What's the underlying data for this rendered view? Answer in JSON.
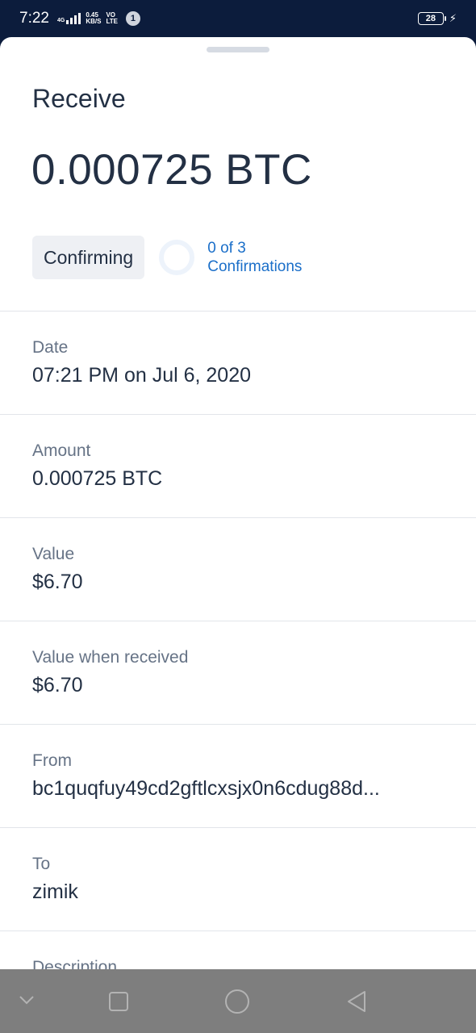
{
  "status_bar": {
    "time": "7:22",
    "network_type": "4G",
    "speed_value": "0.45",
    "speed_unit": "KB/S",
    "volte_top": "VO",
    "volte_bottom": "LTE",
    "notification_count": "1",
    "battery_level": "28",
    "icons": [
      "signal-icon",
      "battery-icon",
      "charging-bolt-icon"
    ]
  },
  "sheet": {
    "title": "Receive",
    "amount": "0.000725 BTC",
    "status_badge": "Confirming",
    "confirmations_line1": "0 of 3",
    "confirmations_line2": "Confirmations",
    "details": [
      {
        "label": "Date",
        "value": "07:21 PM on Jul 6, 2020"
      },
      {
        "label": "Amount",
        "value": "0.000725 BTC"
      },
      {
        "label": "Value",
        "value": "$6.70"
      },
      {
        "label": "Value when received",
        "value": "$6.70"
      },
      {
        "label": "From",
        "value": "bc1quqfuy49cd2gftlcxsjx0n6cdug88d..."
      },
      {
        "label": "To",
        "value": "zimik"
      },
      {
        "label": "Description",
        "value": ""
      }
    ]
  },
  "colors": {
    "accent": "#1b6fc9",
    "text_primary": "#233044",
    "text_secondary": "#667386",
    "status_bar_bg": "#0c1c3c",
    "nav_bar_bg": "#7e7e7e"
  },
  "nav_bar": {
    "icons": [
      "nav-collapse-icon",
      "nav-recents-icon",
      "nav-home-icon",
      "nav-back-icon"
    ]
  }
}
